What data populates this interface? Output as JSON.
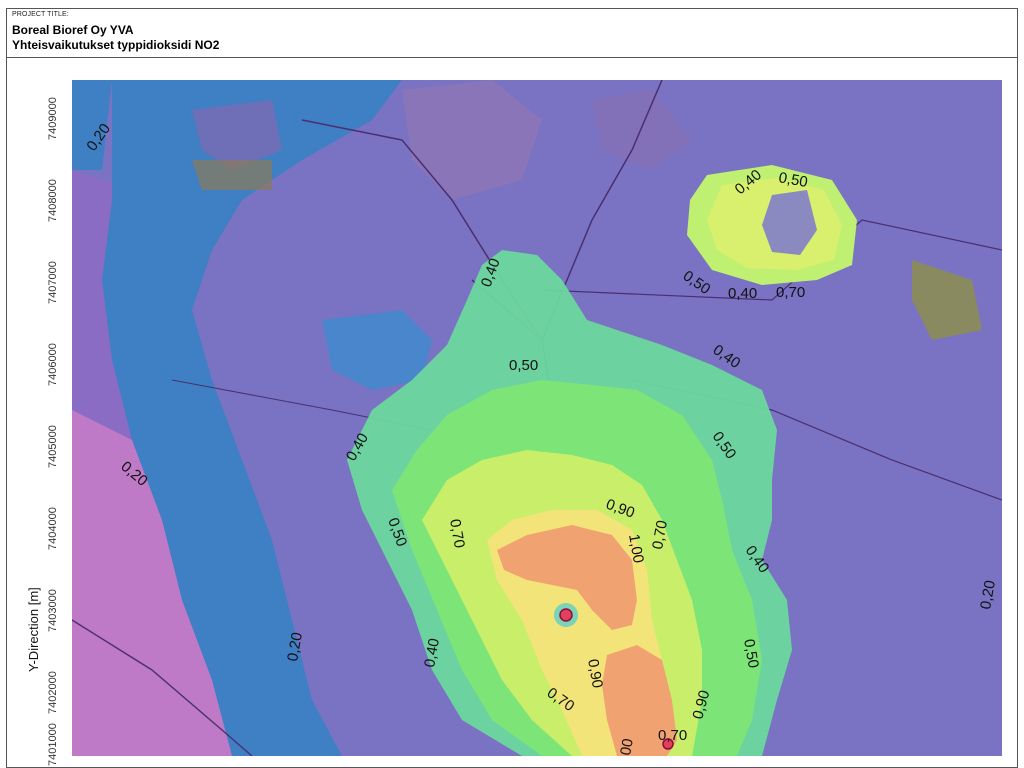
{
  "header": {
    "project_label": "PROJECT TITLE:",
    "title_line1": "Boreal Bioref Oy YVA",
    "title_line2": "Yhteisvaikutukset typpidioksidi NO2"
  },
  "axis": {
    "y_title": "Y-Direction [m]",
    "y_ticks": [
      "7409000",
      "7408000",
      "7407000",
      "7406000",
      "7405000",
      "7404000",
      "7403000",
      "7402000",
      "7401000"
    ]
  },
  "contours": {
    "l020a": "0,20",
    "l020b": "0,20",
    "l020c": "0,20",
    "l020d": "0,20",
    "l040a": "0,40",
    "l040b": "0,40",
    "l040c": "0,40",
    "l040d": "0,40",
    "l040e": "0,40",
    "l040f": "0,40",
    "l050a": "0,50",
    "l050b": "0,50",
    "l050c": "0,50",
    "l050d": "0,50",
    "l050e": "0,50",
    "l070a": "0,70",
    "l070b": "0,70",
    "l070c": "0,70",
    "l070d": "0,70",
    "l070e": "0,70",
    "l090a": "0,90",
    "l090b": "0,90",
    "l090c": "0,90",
    "l100": "1,00",
    "l00": "00"
  },
  "colors": {
    "level_020": "#5f78c6",
    "level_040": "#6dd4a0",
    "level_050": "#7be67c",
    "level_070": "#c8f06a",
    "level_090": "#f6e37a",
    "level_100": "#f0a070",
    "water": "#3f7fc4",
    "land": "#7c6fc0",
    "urban": "#c978c8"
  }
}
